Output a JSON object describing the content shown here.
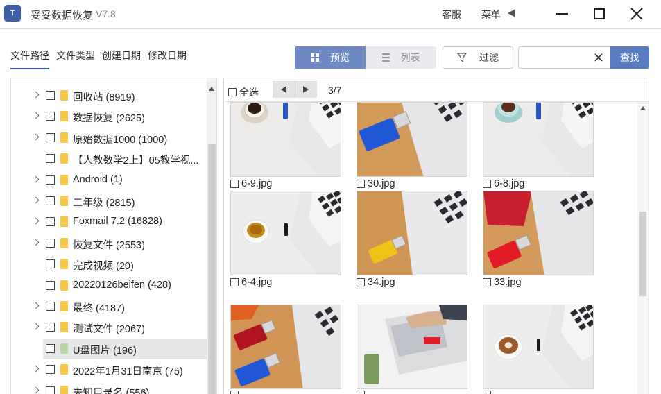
{
  "titlebar": {
    "logo_text": "T",
    "title": "妥妥数据恢复",
    "version": "V7.8",
    "service_label": "客服",
    "menu_label": "菜单"
  },
  "tabs": [
    {
      "label": "文件路径",
      "active": true
    },
    {
      "label": "文件类型",
      "active": false
    },
    {
      "label": "创建日期",
      "active": false
    },
    {
      "label": "修改日期",
      "active": false
    }
  ],
  "toolbar": {
    "grid_label": "预览",
    "list_label": "列表",
    "filter_label": "过滤",
    "search_value": "",
    "search_placeholder": "",
    "search_button": "查找"
  },
  "tree": [
    {
      "label": "回收站  (8919)",
      "expandable": true,
      "selected": false
    },
    {
      "label": "数据恢复  (2625)",
      "expandable": true,
      "selected": false
    },
    {
      "label": "原始数据1000  (1000)",
      "expandable": true,
      "selected": false
    },
    {
      "label": "【人教数学2上】05教学视...",
      "expandable": false,
      "selected": false
    },
    {
      "label": "Android  (1)",
      "expandable": true,
      "selected": false
    },
    {
      "label": "二年级  (2815)",
      "expandable": true,
      "selected": false
    },
    {
      "label": "Foxmail 7.2  (16828)",
      "expandable": true,
      "selected": false
    },
    {
      "label": "恢复文件  (2553)",
      "expandable": true,
      "selected": false
    },
    {
      "label": "完成视频  (20)",
      "expandable": false,
      "selected": false
    },
    {
      "label": "20220126beifen  (428)",
      "expandable": false,
      "selected": false
    },
    {
      "label": "最终  (4187)",
      "expandable": true,
      "selected": false
    },
    {
      "label": "测试文件  (2067)",
      "expandable": true,
      "selected": false
    },
    {
      "label": "U盘图片  (196)",
      "expandable": false,
      "selected": true
    },
    {
      "label": "2022年1月31日南京  (75)",
      "expandable": true,
      "selected": false
    },
    {
      "label": "未知目录名  (556)",
      "expandable": true,
      "selected": false
    }
  ],
  "content": {
    "select_all_label": "全选",
    "page_counter": "3/7",
    "files": [
      {
        "name": "6-9.jpg",
        "scene": "coffee-dark"
      },
      {
        "name": "30.jpg",
        "scene": "usb-blue"
      },
      {
        "name": "6-8.jpg",
        "scene": "coffee-teal"
      },
      {
        "name": "6-4.jpg",
        "scene": "coffee-white"
      },
      {
        "name": "34.jpg",
        "scene": "usb-yellow"
      },
      {
        "name": "33.jpg",
        "scene": "usb-red"
      },
      {
        "name": "",
        "scene": "usb-redblue"
      },
      {
        "name": "",
        "scene": "hand-keyboard"
      },
      {
        "name": "",
        "scene": "latte"
      }
    ]
  },
  "colors": {
    "accent": "#5a7bc0",
    "toggle_active": "#6f89c4",
    "folder": "#f6c84b",
    "folder_selected": "#b7d7a8"
  }
}
